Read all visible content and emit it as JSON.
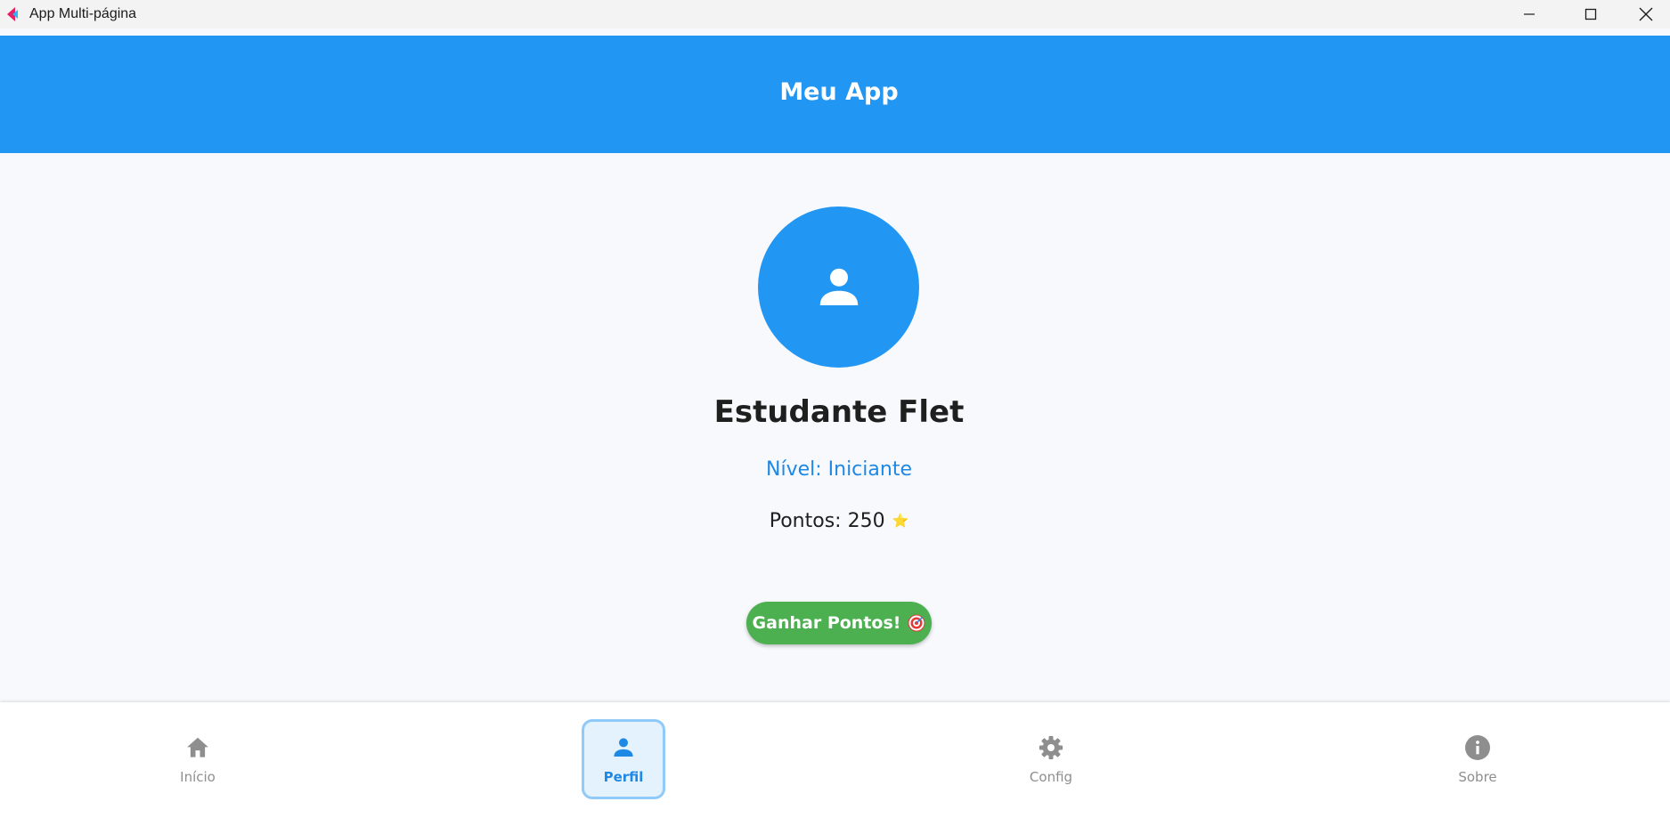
{
  "window": {
    "title": "App Multi-página"
  },
  "appbar": {
    "title": "Meu App"
  },
  "profile": {
    "avatar_icon": "person-icon",
    "name": "Estudante Flet",
    "level": "Nível: Iniciante",
    "points": "Pontos: 250",
    "points_icon": "star-icon",
    "star_glyph": "⭐"
  },
  "actions": {
    "earn_label": "Ganhar Pontos!",
    "earn_icon": "target-icon"
  },
  "nav": {
    "items": [
      {
        "label": "Início",
        "icon": "home-icon",
        "active": false
      },
      {
        "label": "Perfil",
        "icon": "person-icon",
        "active": true
      },
      {
        "label": "Config",
        "icon": "gear-icon",
        "active": false
      },
      {
        "label": "Sobre",
        "icon": "info-icon",
        "active": false
      }
    ]
  },
  "colors": {
    "primary": "#2196f3",
    "level_text": "#1e88e5",
    "button_green": "#4caf50",
    "nav_inactive": "#8e8e8e",
    "nav_active_bg": "#e3f2fd",
    "nav_active_border": "#90caf9"
  }
}
